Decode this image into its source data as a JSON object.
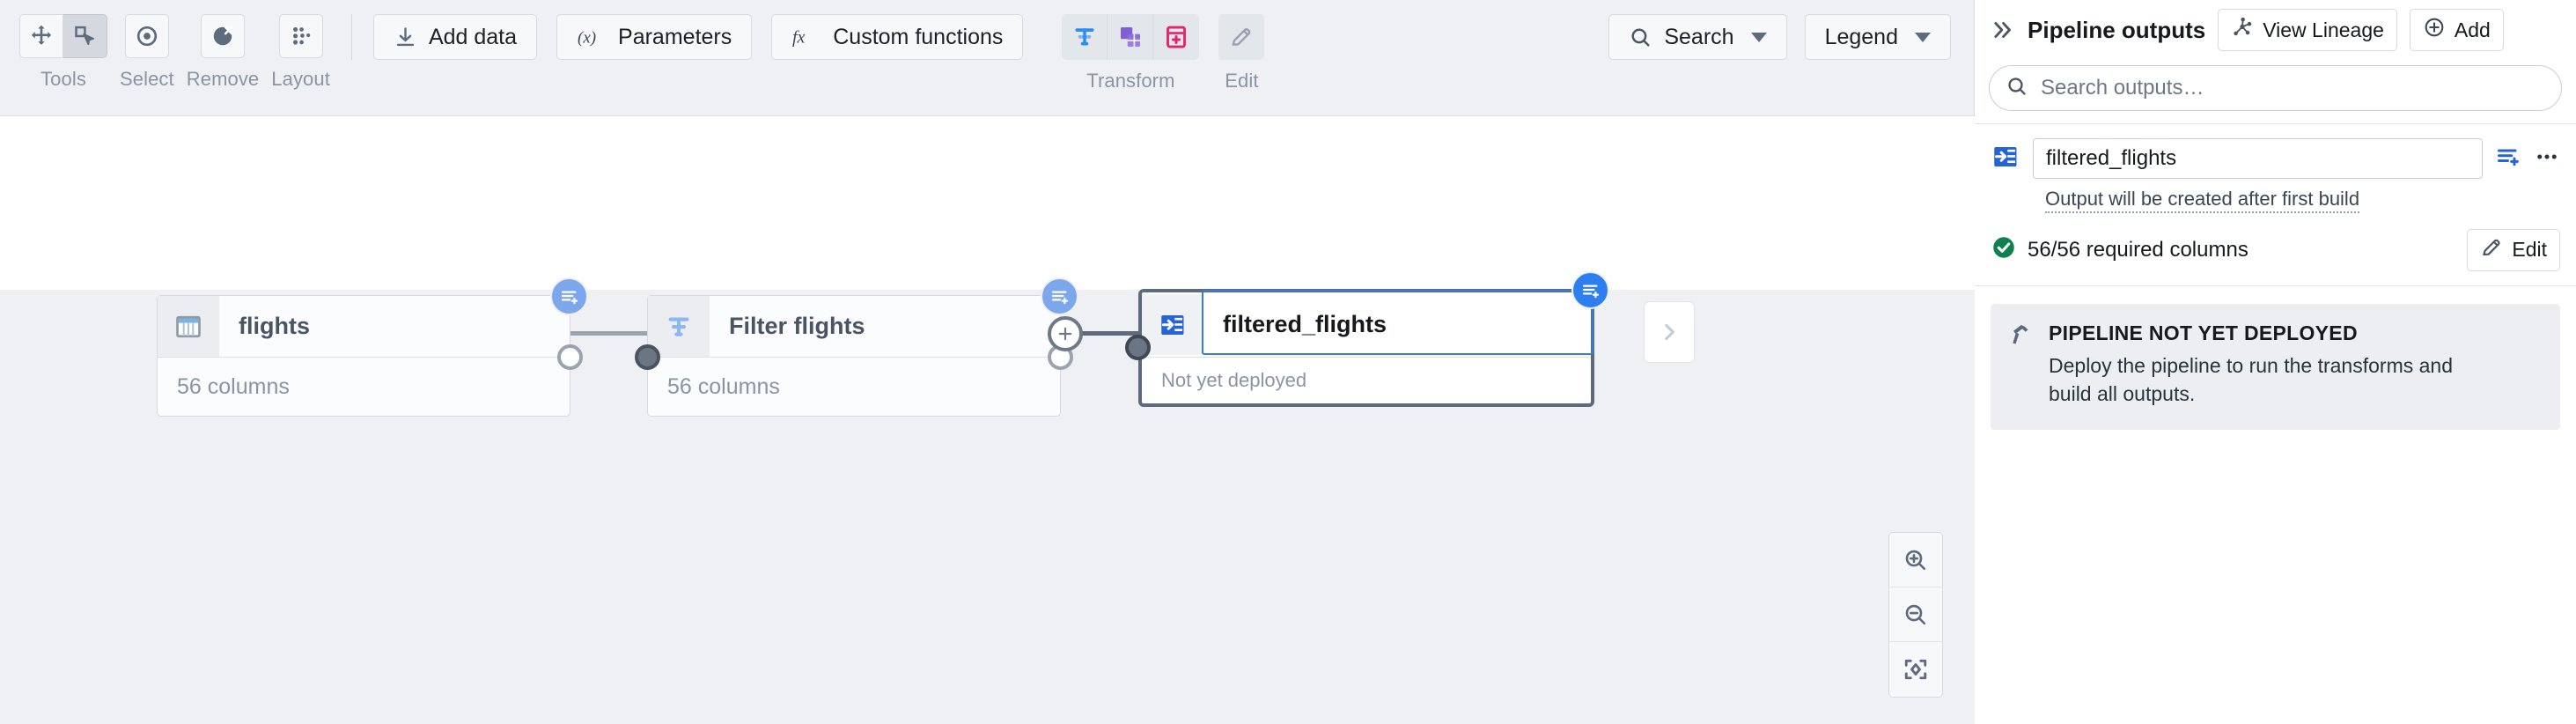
{
  "toolbar": {
    "groups": [
      {
        "label": "Tools",
        "icons": [
          "move-icon",
          "select-cursor-icon"
        ]
      },
      {
        "label": "Select",
        "icons": [
          "target-icon"
        ]
      },
      {
        "label": "Remove",
        "icons": [
          "remove-node-icon"
        ]
      },
      {
        "label": "Layout",
        "icons": [
          "layout-dots-icon"
        ]
      }
    ],
    "add_data_label": "Add data",
    "add_data_icon": "download-icon",
    "parameters_label": "Parameters",
    "parameters_icon": "fx-parens-icon",
    "custom_functions_label": "Custom functions",
    "custom_functions_icon": "fx-italic-icon",
    "transform_label": "Transform",
    "transform_icons": [
      "filter-icon",
      "join-icon",
      "calculator-icon"
    ],
    "edit_label": "Edit",
    "edit_icon": "pencil-icon",
    "search_label": "Search",
    "search_icon": "search-icon",
    "legend_label": "Legend",
    "colors": {
      "filter": "#2d8cf5",
      "join": "#7e5fd4",
      "calculator": "#e2246b",
      "accent": "#2d7ff0"
    }
  },
  "canvas": {
    "nodes": [
      {
        "title": "flights",
        "subtitle": "56 columns",
        "icon": "table-icon",
        "badge_icon": "add-columns-icon",
        "selected": false
      },
      {
        "title": "Filter flights",
        "subtitle": "56 columns",
        "icon": "filter-icon",
        "badge_icon": "add-columns-icon",
        "selected": false
      },
      {
        "title": "filtered_flights",
        "subtitle": "Not yet deployed",
        "icon": "dataset-output-icon",
        "badge_icon": "add-columns-icon",
        "selected": true
      }
    ],
    "add_edge_icon": "plus-circle-icon",
    "expand_icon": "chevron-right-icon",
    "zoom_controls": [
      {
        "name": "zoom-in",
        "icon": "zoom-in-icon"
      },
      {
        "name": "zoom-out",
        "icon": "zoom-out-icon"
      },
      {
        "name": "fit-to-screen",
        "icon": "fit-screen-icon"
      }
    ]
  },
  "right_panel": {
    "collapse_icon": "double-chevron-right-icon",
    "title": "Pipeline outputs",
    "view_lineage_label": "View Lineage",
    "view_lineage_icon": "lineage-graph-icon",
    "add_label": "Add",
    "add_icon": "plus-circle-icon",
    "search_placeholder": "Search outputs…",
    "search_value": "",
    "search_icon": "search-icon",
    "output": {
      "icon": "dataset-output-icon",
      "name_value": "filtered_flights",
      "note": "Output will be created after first build",
      "columns_icon": "add-columns-icon",
      "more_icon": "more-horizontal-icon",
      "status_icon": "check-circle-icon",
      "status_color": "#0f8050",
      "columns_text": "56/56 required columns",
      "edit_label": "Edit",
      "edit_icon": "pencil-icon"
    },
    "notice": {
      "icon": "hammer-icon",
      "title": "PIPELINE NOT YET DEPLOYED",
      "body": "Deploy the pipeline to run the transforms and build all outputs."
    }
  }
}
